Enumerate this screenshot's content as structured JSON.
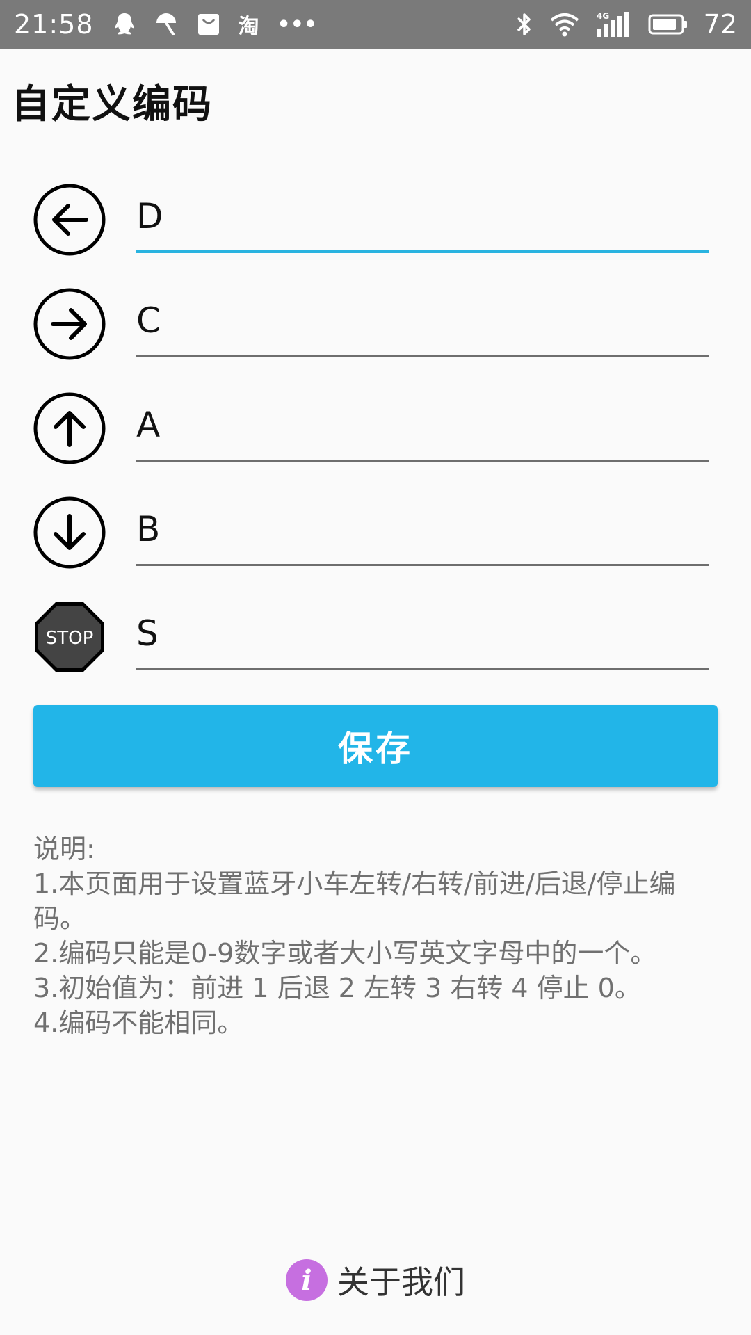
{
  "status_bar": {
    "time": "21:58",
    "left_icons": [
      "qq-icon",
      "umbrella-icon",
      "shopping-bag-icon",
      "taobao-icon",
      "more-dots-icon"
    ],
    "taobao_glyph": "淘",
    "more_glyph": "•••",
    "network_label": "4G",
    "battery_level": "72"
  },
  "page": {
    "title": "自定义编码"
  },
  "codes": [
    {
      "direction": "left",
      "icon": "arrow-left-circle-icon",
      "value": "D"
    },
    {
      "direction": "right",
      "icon": "arrow-right-circle-icon",
      "value": "C"
    },
    {
      "direction": "forward",
      "icon": "arrow-up-circle-icon",
      "value": "A"
    },
    {
      "direction": "backward",
      "icon": "arrow-down-circle-icon",
      "value": "B"
    },
    {
      "direction": "stop",
      "icon": "stop-sign-icon",
      "value": "S",
      "icon_text": "STOP"
    }
  ],
  "save_button": {
    "label": "保存",
    "color": "#22b5e8"
  },
  "instructions": {
    "heading": "说明:",
    "lines": [
      "1.本页面用于设置蓝牙小车左转/右转/前进/后退/停止编码。",
      "2.编码只能是0-9数字或者大小写英文字母中的一个。",
      "3.初始值为：前进 1 后退 2 左转 3 右转 4 停止 0。",
      "4.编码不能相同。"
    ]
  },
  "footer": {
    "about_label": "关于我们",
    "info_icon_glyph": "i",
    "info_icon_color": "#c66fe0"
  },
  "colors": {
    "accent": "#29b3e0",
    "status_bar_bg": "#7a7a7a",
    "background": "#fafafa"
  }
}
